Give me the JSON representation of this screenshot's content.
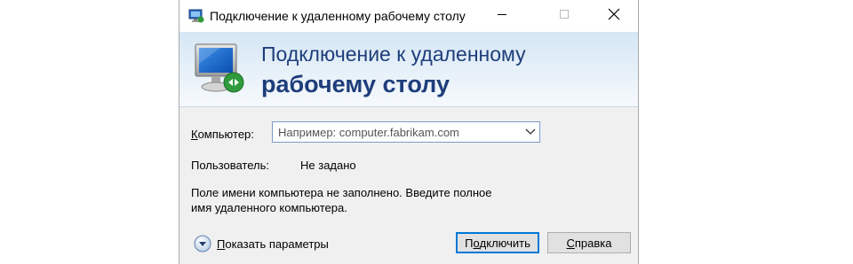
{
  "window": {
    "title": "Подключение к удаленному рабочему столу",
    "icon": "remote-desktop-icon"
  },
  "titlebar_buttons": {
    "minimize": "minimize-icon",
    "maximize": "maximize-icon",
    "close": "close-icon"
  },
  "banner": {
    "line1": "Подключение к удаленному",
    "line2": "рабочему столу",
    "icon": "remote-desktop-monitor-icon"
  },
  "form": {
    "computer_label_accel": "К",
    "computer_label_rest": "омпьютер:",
    "computer_placeholder": "Например: computer.fabrikam.com",
    "computer_value": "",
    "user_label": "Пользователь:",
    "user_value": "Не задано"
  },
  "message": {
    "line1": "Поле имени компьютера не заполнено. Введите полное",
    "line2": "имя удаленного компьютера."
  },
  "footer": {
    "show_params_accel": "П",
    "show_params_rest": "оказать параметры",
    "connect_accel": "о",
    "connect_pre": "П",
    "connect_rest": "дключить",
    "help_accel": "С",
    "help_rest": "правка"
  },
  "colors": {
    "banner_text": "#1e3d7a",
    "default_button_border": "#0078d7"
  }
}
